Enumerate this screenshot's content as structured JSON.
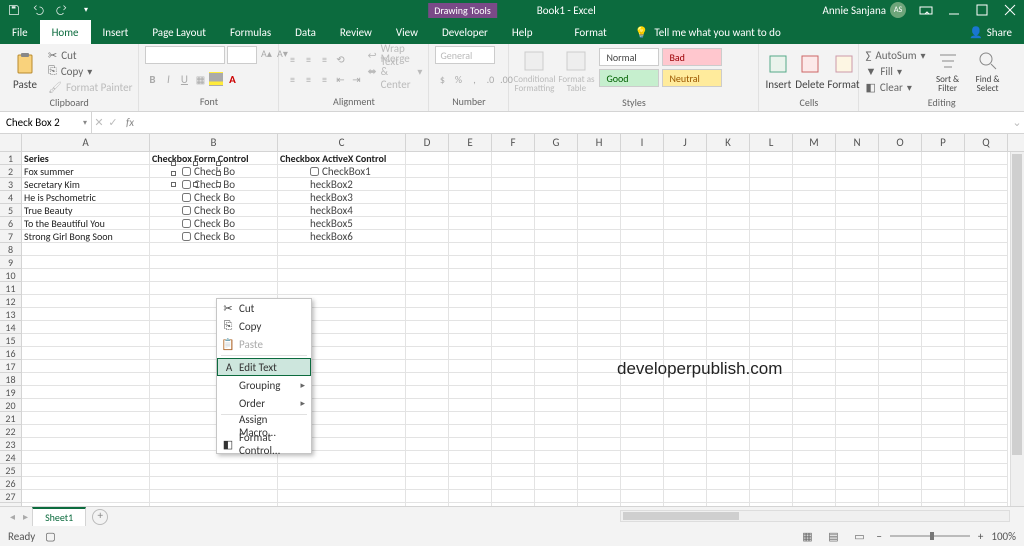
{
  "titlebar": {
    "context_tool": "Drawing Tools",
    "doc": "Book1 - Excel",
    "user_name": "Annie Sanjana",
    "user_initials": "AS"
  },
  "tabs": {
    "file": "File",
    "home": "Home",
    "insert": "Insert",
    "page_layout": "Page Layout",
    "formulas": "Formulas",
    "data": "Data",
    "review": "Review",
    "view": "View",
    "developer": "Developer",
    "help": "Help",
    "format": "Format",
    "tell_me": "Tell me what you want to do",
    "share": "Share"
  },
  "ribbon": {
    "clipboard": {
      "label": "Clipboard",
      "paste": "Paste",
      "cut": "Cut",
      "copy": "Copy",
      "painter": "Format Painter"
    },
    "font": {
      "label": "Font"
    },
    "alignment": {
      "label": "Alignment",
      "wrap": "Wrap Text",
      "merge": "Merge & Center"
    },
    "number": {
      "label": "Number",
      "general": "General"
    },
    "styles": {
      "label": "Styles",
      "cond": "Conditional Formatting",
      "table": "Format as Table",
      "normal": "Normal",
      "bad": "Bad",
      "good": "Good",
      "neutral": "Neutral"
    },
    "cells": {
      "label": "Cells",
      "insert": "Insert",
      "delete": "Delete",
      "format": "Format"
    },
    "editing": {
      "label": "Editing",
      "autosum": "AutoSum",
      "fill": "Fill",
      "clear": "Clear",
      "sort": "Sort & Filter",
      "find": "Find & Select"
    }
  },
  "namebox": "Check Box 2",
  "columns": [
    "A",
    "B",
    "C",
    "D",
    "E",
    "F",
    "G",
    "H",
    "I",
    "J",
    "K",
    "L",
    "M",
    "N",
    "O",
    "P",
    "Q"
  ],
  "data_rows": {
    "r1": {
      "A": "Series",
      "B": "Checkbox Form Control",
      "C": "Checkbox ActiveX Control"
    },
    "r2": {
      "A": "Fox summer"
    },
    "r3": {
      "A": "Secretary Kim"
    },
    "r4": {
      "A": "He is Pschometric"
    },
    "r5": {
      "A": "True Beauty"
    },
    "r6": {
      "A": "To the Beautiful You"
    },
    "r7": {
      "A": "Strong Girl Bong Soon"
    }
  },
  "form_cbx_label": "Check Bo",
  "activex_labels": [
    "CheckBox1",
    "heckBox2",
    "heckBox3",
    "heckBox4",
    "heckBox5",
    "heckBox6"
  ],
  "context_menu": {
    "cut": "Cut",
    "copy": "Copy",
    "paste": "Paste",
    "edit_text": "Edit Text",
    "grouping": "Grouping",
    "order": "Order",
    "assign_macro": "Assign Macro...",
    "format_control": "Format Control..."
  },
  "sheet_tab": "Sheet1",
  "status": {
    "ready": "Ready",
    "zoom": "100%"
  },
  "watermark": "developerpublish.com"
}
